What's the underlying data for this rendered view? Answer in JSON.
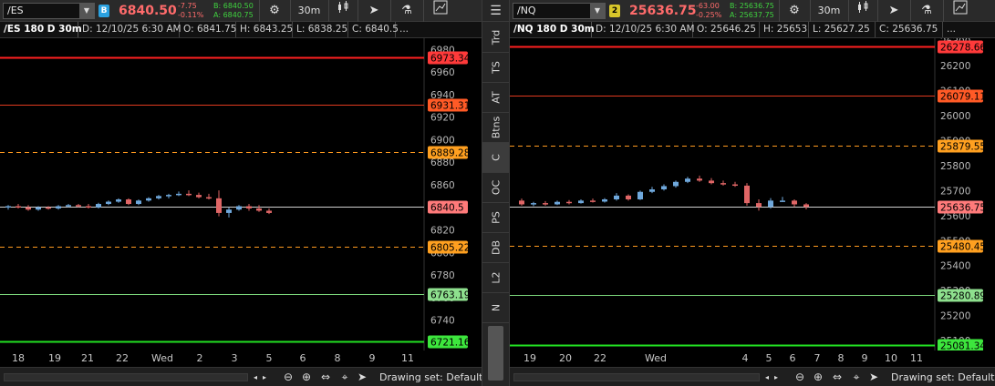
{
  "panels": [
    {
      "id": "es",
      "symbol": "/ES",
      "link_badge": "B",
      "link_color": "#2aa1e0",
      "last_price": "6840.50",
      "change": "-7.75",
      "change_pct": "-0.11%",
      "bid": "B: 6840.50",
      "ask": "A: 6840.75",
      "timeframe": "30m",
      "info": {
        "desc": "/ES 180 D 30m",
        "date": "D: 12/10/25 6:30 AM",
        "open": "O: 6841.75",
        "high": "H: 6843.25",
        "low": "L: 6838.25",
        "close": "C: 6840.5",
        "more": "..."
      },
      "chart_data": {
        "type": "candlestick",
        "ylim": [
          6713,
          6990
        ],
        "y_ticks": [
          6980,
          6960,
          6940,
          6920,
          6900,
          6880,
          6860,
          6840,
          6820,
          6800,
          6780,
          6760,
          6740
        ],
        "x_ticks": [
          "18",
          "19",
          "21",
          "22",
          "Wed",
          "2",
          "3",
          "5",
          "6",
          "8",
          "9",
          "11"
        ],
        "levels": [
          {
            "value": 6973.34,
            "label": "6973.34",
            "style": "solid-thick",
            "color": "#ff2020",
            "tag_color": "#ff3a3a"
          },
          {
            "value": 6931.31,
            "label": "6931.31",
            "style": "solid",
            "color": "#e03a1f",
            "tag_color": "#ff5a26"
          },
          {
            "value": 6889.28,
            "label": "6889.28",
            "style": "dashed",
            "color": "#ff9a1f",
            "tag_color": "#ffa020"
          },
          {
            "value": 6840.5,
            "label": "6840.5",
            "style": "solid-thin",
            "color": "#d0d0d0",
            "tag_color": "#ff7a7a"
          },
          {
            "value": 6805.22,
            "label": "6805.22",
            "style": "dashed",
            "color": "#ff9a1f",
            "tag_color": "#ffa020"
          },
          {
            "value": 6763.19,
            "label": "6763.19",
            "style": "solid",
            "color": "#7bd67b",
            "tag_color": "#8ee08e"
          },
          {
            "value": 6721.16,
            "label": "6721.16",
            "style": "solid-thick",
            "color": "#22e022",
            "tag_color": "#3de63d"
          }
        ],
        "candles": [
          [
            6840,
            6842,
            6838,
            6841
          ],
          [
            6841,
            6843,
            6839,
            6840
          ],
          [
            6840,
            6842,
            6837,
            6838
          ],
          [
            6838,
            6841,
            6837,
            6840
          ],
          [
            6840,
            6841,
            6838,
            6839
          ],
          [
            6839,
            6842,
            6838,
            6841
          ],
          [
            6841,
            6843,
            6840,
            6842
          ],
          [
            6842,
            6843,
            6840,
            6841
          ],
          [
            6841,
            6843,
            6839,
            6840
          ],
          [
            6840,
            6844,
            6839,
            6843
          ],
          [
            6843,
            6846,
            6842,
            6845
          ],
          [
            6845,
            6848,
            6844,
            6847
          ],
          [
            6847,
            6848,
            6842,
            6843
          ],
          [
            6843,
            6847,
            6842,
            6846
          ],
          [
            6846,
            6849,
            6845,
            6848
          ],
          [
            6848,
            6851,
            6847,
            6850
          ],
          [
            6850,
            6852,
            6848,
            6851
          ],
          [
            6851,
            6854,
            6850,
            6852
          ],
          [
            6852,
            6855,
            6850,
            6851
          ],
          [
            6851,
            6853,
            6848,
            6849
          ],
          [
            6849,
            6852,
            6847,
            6848
          ],
          [
            6848,
            6855,
            6832,
            6835
          ],
          [
            6835,
            6840,
            6831,
            6838
          ],
          [
            6838,
            6842,
            6837,
            6841
          ],
          [
            6841,
            6843,
            6837,
            6839
          ],
          [
            6839,
            6842,
            6836,
            6837
          ],
          [
            6837,
            6839,
            6834,
            6835
          ]
        ]
      }
    },
    {
      "id": "nq",
      "symbol": "/NQ",
      "link_badge": "2",
      "link_color": "#d7c62a",
      "last_price": "25636.75",
      "change": "-63.00",
      "change_pct": "-0.25%",
      "bid": "B: 25636.75",
      "ask": "A: 25637.75",
      "timeframe": "30m",
      "info": {
        "desc": "/NQ 180 D 30m",
        "date": "D: 12/10/25 6:30 AM",
        "open": "O: 25646.25",
        "high": "H: 25653",
        "low": "L: 25627.25",
        "close": "C: 25636.75",
        "more": "..."
      },
      "chart_data": {
        "type": "candlestick",
        "ylim": [
          25060,
          26310
        ],
        "y_ticks": [
          26300,
          26200,
          26100,
          26000,
          25900,
          25800,
          25700,
          25600,
          25500,
          25400,
          25300,
          25200,
          25100
        ],
        "x_ticks": [
          "19",
          "20",
          "22",
          "Wed",
          "4",
          "5",
          "6",
          "7",
          "8",
          "9",
          "10",
          "11"
        ],
        "levels": [
          {
            "value": 26278.66,
            "label": "26278.66",
            "style": "solid-thick",
            "color": "#ff2020",
            "tag_color": "#ff3a3a"
          },
          {
            "value": 26079.11,
            "label": "26079.11",
            "style": "solid",
            "color": "#e03a1f",
            "tag_color": "#ff5a26"
          },
          {
            "value": 25879.55,
            "label": "25879.55",
            "style": "dashed",
            "color": "#ff9a1f",
            "tag_color": "#ffa020"
          },
          {
            "value": 25636.75,
            "label": "25636.75",
            "style": "solid-thin",
            "color": "#d0d0d0",
            "tag_color": "#ff7a7a"
          },
          {
            "value": 25480.45,
            "label": "25480.45",
            "style": "dashed",
            "color": "#ff9a1f",
            "tag_color": "#ffa020"
          },
          {
            "value": 25280.89,
            "label": "25280.89",
            "style": "solid",
            "color": "#7bd67b",
            "tag_color": "#8ee08e"
          },
          {
            "value": 25081.34,
            "label": "25081.34",
            "style": "solid-thick",
            "color": "#22e022",
            "tag_color": "#3de63d"
          }
        ],
        "candles": [
          [
            25660,
            25668,
            25640,
            25645
          ],
          [
            25645,
            25655,
            25638,
            25650
          ],
          [
            25650,
            25658,
            25640,
            25645
          ],
          [
            25645,
            25660,
            25642,
            25655
          ],
          [
            25655,
            25662,
            25645,
            25650
          ],
          [
            25650,
            25665,
            25648,
            25660
          ],
          [
            25660,
            25668,
            25652,
            25656
          ],
          [
            25656,
            25670,
            25652,
            25665
          ],
          [
            25665,
            25690,
            25660,
            25680
          ],
          [
            25680,
            25685,
            25660,
            25665
          ],
          [
            25665,
            25700,
            25662,
            25695
          ],
          [
            25695,
            25715,
            25690,
            25705
          ],
          [
            25705,
            25725,
            25700,
            25718
          ],
          [
            25718,
            25740,
            25712,
            25735
          ],
          [
            25735,
            25755,
            25730,
            25748
          ],
          [
            25748,
            25760,
            25735,
            25740
          ],
          [
            25740,
            25750,
            25725,
            25730
          ],
          [
            25730,
            25740,
            25720,
            25725
          ],
          [
            25725,
            25735,
            25715,
            25720
          ],
          [
            25720,
            25730,
            25640,
            25650
          ],
          [
            25650,
            25665,
            25620,
            25635
          ],
          [
            25635,
            25670,
            25628,
            25660
          ],
          [
            25660,
            25675,
            25655,
            25660
          ],
          [
            25660,
            25665,
            25635,
            25645
          ],
          [
            25645,
            25650,
            25625,
            25635
          ]
        ]
      }
    }
  ],
  "sidebar": {
    "tabs": [
      "Trd",
      "TS",
      "AT",
      "Btns",
      "C",
      "OC",
      "PS",
      "DB",
      "L2",
      "N"
    ],
    "active": "C"
  },
  "bottom": {
    "drawing_set": "Drawing set: Default"
  },
  "colors": {
    "up": "#6fa8dc",
    "down": "#e06666"
  }
}
